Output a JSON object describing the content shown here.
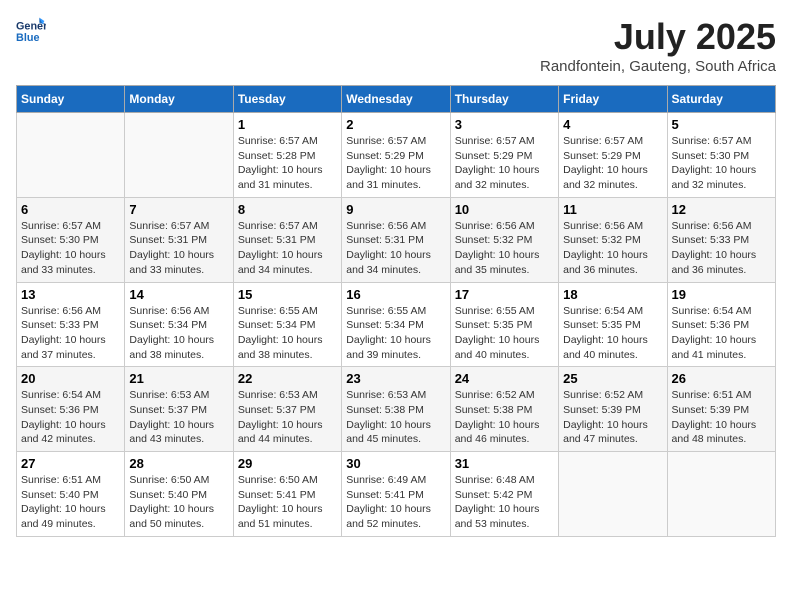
{
  "header": {
    "logo_line1": "General",
    "logo_line2": "Blue",
    "month_title": "July 2025",
    "subtitle": "Randfontein, Gauteng, South Africa"
  },
  "weekdays": [
    "Sunday",
    "Monday",
    "Tuesday",
    "Wednesday",
    "Thursday",
    "Friday",
    "Saturday"
  ],
  "weeks": [
    [
      {
        "day": "",
        "info": ""
      },
      {
        "day": "",
        "info": ""
      },
      {
        "day": "1",
        "info": "Sunrise: 6:57 AM\nSunset: 5:28 PM\nDaylight: 10 hours and 31 minutes."
      },
      {
        "day": "2",
        "info": "Sunrise: 6:57 AM\nSunset: 5:29 PM\nDaylight: 10 hours and 31 minutes."
      },
      {
        "day": "3",
        "info": "Sunrise: 6:57 AM\nSunset: 5:29 PM\nDaylight: 10 hours and 32 minutes."
      },
      {
        "day": "4",
        "info": "Sunrise: 6:57 AM\nSunset: 5:29 PM\nDaylight: 10 hours and 32 minutes."
      },
      {
        "day": "5",
        "info": "Sunrise: 6:57 AM\nSunset: 5:30 PM\nDaylight: 10 hours and 32 minutes."
      }
    ],
    [
      {
        "day": "6",
        "info": "Sunrise: 6:57 AM\nSunset: 5:30 PM\nDaylight: 10 hours and 33 minutes."
      },
      {
        "day": "7",
        "info": "Sunrise: 6:57 AM\nSunset: 5:31 PM\nDaylight: 10 hours and 33 minutes."
      },
      {
        "day": "8",
        "info": "Sunrise: 6:57 AM\nSunset: 5:31 PM\nDaylight: 10 hours and 34 minutes."
      },
      {
        "day": "9",
        "info": "Sunrise: 6:56 AM\nSunset: 5:31 PM\nDaylight: 10 hours and 34 minutes."
      },
      {
        "day": "10",
        "info": "Sunrise: 6:56 AM\nSunset: 5:32 PM\nDaylight: 10 hours and 35 minutes."
      },
      {
        "day": "11",
        "info": "Sunrise: 6:56 AM\nSunset: 5:32 PM\nDaylight: 10 hours and 36 minutes."
      },
      {
        "day": "12",
        "info": "Sunrise: 6:56 AM\nSunset: 5:33 PM\nDaylight: 10 hours and 36 minutes."
      }
    ],
    [
      {
        "day": "13",
        "info": "Sunrise: 6:56 AM\nSunset: 5:33 PM\nDaylight: 10 hours and 37 minutes."
      },
      {
        "day": "14",
        "info": "Sunrise: 6:56 AM\nSunset: 5:34 PM\nDaylight: 10 hours and 38 minutes."
      },
      {
        "day": "15",
        "info": "Sunrise: 6:55 AM\nSunset: 5:34 PM\nDaylight: 10 hours and 38 minutes."
      },
      {
        "day": "16",
        "info": "Sunrise: 6:55 AM\nSunset: 5:34 PM\nDaylight: 10 hours and 39 minutes."
      },
      {
        "day": "17",
        "info": "Sunrise: 6:55 AM\nSunset: 5:35 PM\nDaylight: 10 hours and 40 minutes."
      },
      {
        "day": "18",
        "info": "Sunrise: 6:54 AM\nSunset: 5:35 PM\nDaylight: 10 hours and 40 minutes."
      },
      {
        "day": "19",
        "info": "Sunrise: 6:54 AM\nSunset: 5:36 PM\nDaylight: 10 hours and 41 minutes."
      }
    ],
    [
      {
        "day": "20",
        "info": "Sunrise: 6:54 AM\nSunset: 5:36 PM\nDaylight: 10 hours and 42 minutes."
      },
      {
        "day": "21",
        "info": "Sunrise: 6:53 AM\nSunset: 5:37 PM\nDaylight: 10 hours and 43 minutes."
      },
      {
        "day": "22",
        "info": "Sunrise: 6:53 AM\nSunset: 5:37 PM\nDaylight: 10 hours and 44 minutes."
      },
      {
        "day": "23",
        "info": "Sunrise: 6:53 AM\nSunset: 5:38 PM\nDaylight: 10 hours and 45 minutes."
      },
      {
        "day": "24",
        "info": "Sunrise: 6:52 AM\nSunset: 5:38 PM\nDaylight: 10 hours and 46 minutes."
      },
      {
        "day": "25",
        "info": "Sunrise: 6:52 AM\nSunset: 5:39 PM\nDaylight: 10 hours and 47 minutes."
      },
      {
        "day": "26",
        "info": "Sunrise: 6:51 AM\nSunset: 5:39 PM\nDaylight: 10 hours and 48 minutes."
      }
    ],
    [
      {
        "day": "27",
        "info": "Sunrise: 6:51 AM\nSunset: 5:40 PM\nDaylight: 10 hours and 49 minutes."
      },
      {
        "day": "28",
        "info": "Sunrise: 6:50 AM\nSunset: 5:40 PM\nDaylight: 10 hours and 50 minutes."
      },
      {
        "day": "29",
        "info": "Sunrise: 6:50 AM\nSunset: 5:41 PM\nDaylight: 10 hours and 51 minutes."
      },
      {
        "day": "30",
        "info": "Sunrise: 6:49 AM\nSunset: 5:41 PM\nDaylight: 10 hours and 52 minutes."
      },
      {
        "day": "31",
        "info": "Sunrise: 6:48 AM\nSunset: 5:42 PM\nDaylight: 10 hours and 53 minutes."
      },
      {
        "day": "",
        "info": ""
      },
      {
        "day": "",
        "info": ""
      }
    ]
  ]
}
